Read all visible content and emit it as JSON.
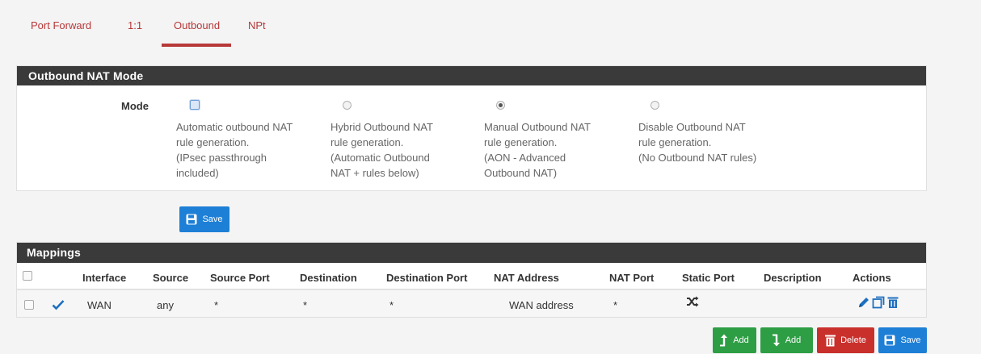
{
  "tabs": [
    {
      "label": "Port Forward",
      "active": false
    },
    {
      "label": "1:1",
      "active": false
    },
    {
      "label": "Outbound",
      "active": true
    },
    {
      "label": "NPt",
      "active": false
    }
  ],
  "mode_panel": {
    "title": "Outbound NAT Mode",
    "mode_label": "Mode",
    "options": [
      {
        "lines": [
          "Automatic outbound NAT",
          "rule generation.",
          "(IPsec passthrough",
          "included)"
        ],
        "selected": false
      },
      {
        "lines": [
          "Hybrid Outbound NAT",
          "rule generation.",
          "(Automatic Outbound",
          "NAT + rules below)"
        ],
        "selected": false
      },
      {
        "lines": [
          "Manual Outbound NAT",
          "rule generation.",
          "(AON - Advanced",
          "Outbound NAT)"
        ],
        "selected": true
      },
      {
        "lines": [
          "Disable Outbound NAT",
          "rule generation.",
          "(No Outbound NAT rules)"
        ],
        "selected": false
      }
    ],
    "save_label": "Save"
  },
  "mappings": {
    "title": "Mappings",
    "columns": [
      "Interface",
      "Source",
      "Source Port",
      "Destination",
      "Destination Port",
      "NAT Address",
      "NAT Port",
      "Static Port",
      "Description",
      "Actions"
    ],
    "rows": [
      {
        "interface": "WAN",
        "source": "any",
        "source_port": "*",
        "destination": "*",
        "destination_port": "*",
        "nat_address": "WAN address",
        "nat_port": "*",
        "static_port_icon": "shuffle-icon",
        "description": ""
      }
    ]
  },
  "footer_buttons": {
    "add_top": "Add",
    "add_bottom": "Add",
    "delete": "Delete",
    "save": "Save"
  },
  "colors": {
    "accent_red": "#b73838",
    "header_dark": "#3a3a3a",
    "primary_blue": "#1e7fd6",
    "success_green": "#2e9e45",
    "danger_red": "#c9302c"
  }
}
